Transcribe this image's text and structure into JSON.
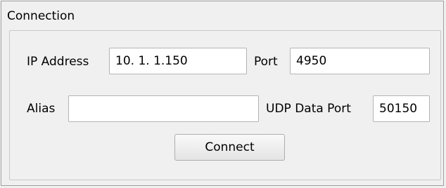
{
  "connection": {
    "title": "Connection",
    "ip_label": "IP Address",
    "ip_value": "10. 1. 1.150",
    "port_label": "Port",
    "port_value": "4950",
    "alias_label": "Alias",
    "alias_value": "",
    "udp_label": "UDP Data Port",
    "udp_value": "50150",
    "connect_label": "Connect"
  }
}
